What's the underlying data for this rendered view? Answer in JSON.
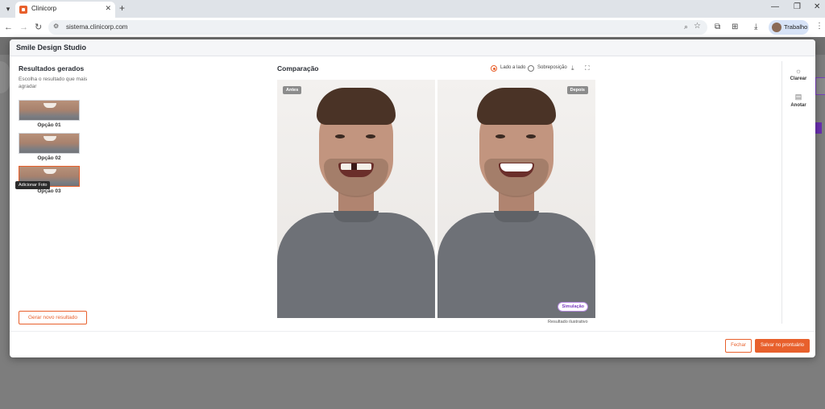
{
  "browser": {
    "tab_title": "Clinicorp",
    "tab_close": "✕",
    "new_tab": "+",
    "url": "sistema.clinicorp.com",
    "profile_label": "Trabalho",
    "win_minimize": "—",
    "win_restore": "❐",
    "win_close": "✕"
  },
  "modal": {
    "title": "Smile Design Studio"
  },
  "results": {
    "title": "Resultados gerados",
    "subtitle": "Escolha o resultado que mais agradar",
    "options": [
      {
        "label": "Opção 01"
      },
      {
        "label": "Opção 02"
      },
      {
        "label": "Opção 03"
      }
    ],
    "tooltip": "Adicionar Foto",
    "generate_button": "Gerar novo resultado"
  },
  "comparison": {
    "title": "Comparação",
    "modes": [
      {
        "label": "Lado a lado",
        "selected": true
      },
      {
        "label": "Sobreposição",
        "selected": false
      }
    ],
    "before_badge": "Antes",
    "after_badge": "Depois",
    "simulation_badge": "Simulação",
    "footnote": "Resultado ilustrativo"
  },
  "side_tools": [
    {
      "label": "Clarear",
      "icon": "sun-icon"
    },
    {
      "label": "Anotar",
      "icon": "note-icon"
    }
  ],
  "footer": {
    "close_button": "Fechar",
    "save_button": "Salvar no prontuário"
  },
  "colors": {
    "accent": "#e8602c",
    "simulation": "#7b3fbf"
  }
}
